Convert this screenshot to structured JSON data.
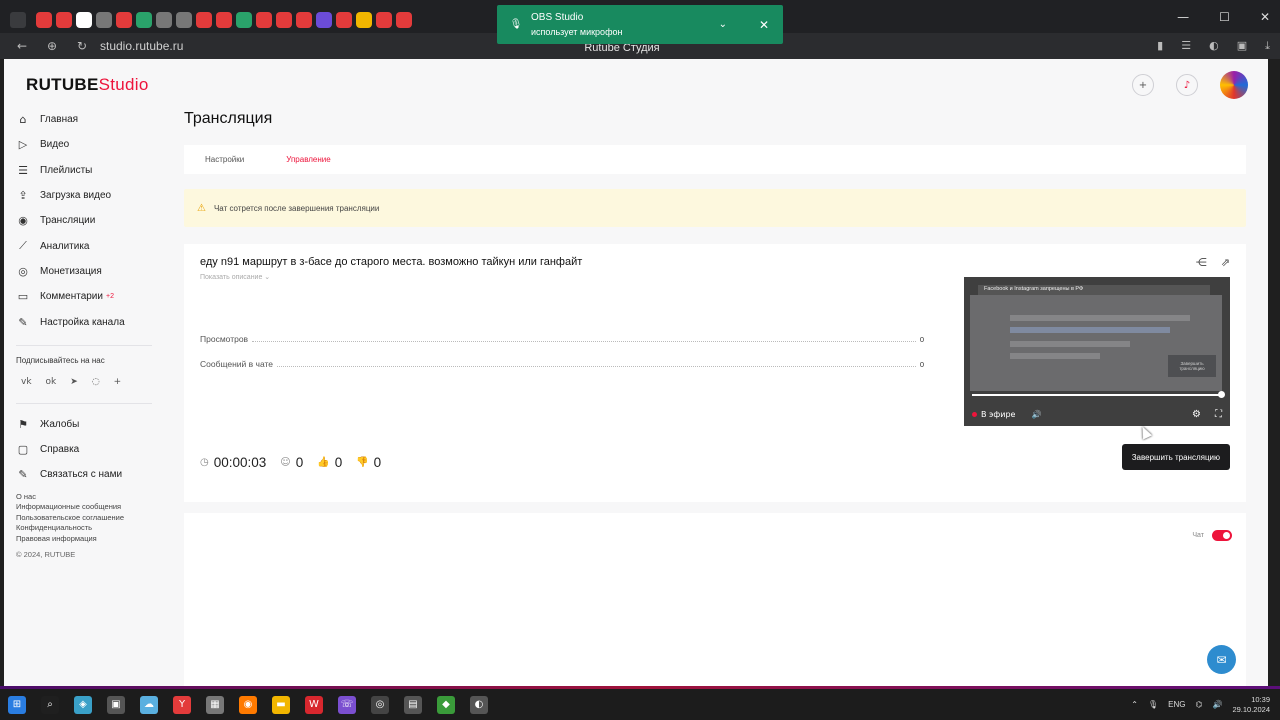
{
  "browser": {
    "url": "studio.rutube.ru",
    "page_title": "Rutube Студия",
    "tab_icon_colors": [
      "#e33b3b",
      "#e33b3b",
      "#ffffff",
      "#777777",
      "#e33b3b",
      "#2aa36b",
      "#777777",
      "#777777",
      "#e33b3b",
      "#e33b3b",
      "#2aa36b",
      "#e33b3b",
      "#e33b3b",
      "#e33b3b",
      "#6b4cd8",
      "#e33b3b",
      "#f2b600",
      "#e33b3b",
      "#e33b3b"
    ]
  },
  "obs_toast": {
    "title": "OBS Studio",
    "message": "использует микрофон"
  },
  "logo": {
    "part1": "RUTUBE",
    "part2": "Studio"
  },
  "sidebar": {
    "items": [
      {
        "label": "Главная",
        "icon": "home-icon",
        "glyph": "⌂"
      },
      {
        "label": "Видео",
        "icon": "video-icon",
        "glyph": "▷"
      },
      {
        "label": "Плейлисты",
        "icon": "playlist-icon",
        "glyph": "☰"
      },
      {
        "label": "Загрузка видео",
        "icon": "upload-icon",
        "glyph": "⇪"
      },
      {
        "label": "Трансляции",
        "icon": "broadcast-icon",
        "glyph": "◉"
      },
      {
        "label": "Аналитика",
        "icon": "analytics-icon",
        "glyph": "⟋"
      },
      {
        "label": "Монетизация",
        "icon": "monetization-icon",
        "glyph": "◎"
      },
      {
        "label": "Комментарии",
        "icon": "comments-icon",
        "glyph": "▭",
        "badge": "+2"
      },
      {
        "label": "Настройка канала",
        "icon": "channel-settings-icon",
        "glyph": "✎"
      }
    ],
    "subscribe_label": "Подписывайтесь на нас",
    "secondary_items": [
      {
        "label": "Жалобы",
        "icon": "flag-icon",
        "glyph": "⚑"
      },
      {
        "label": "Справка",
        "icon": "help-icon",
        "glyph": "▢"
      },
      {
        "label": "Связаться с нами",
        "icon": "contact-icon",
        "glyph": "✎"
      }
    ],
    "footer_links": [
      "О нас",
      "Информационные сообщения",
      "Пользовательское соглашение",
      "Конфиденциальность",
      "Правовая информация"
    ],
    "copyright": "© 2024, RUTUBE"
  },
  "main": {
    "page_title": "Трансляция",
    "tabs": [
      {
        "label": "Настройки",
        "active": false
      },
      {
        "label": "Управление",
        "active": true
      }
    ],
    "warning": "Чат сотрется после завершения трансляции",
    "stream": {
      "title": "еду n91 маршрут в з-басе до старого места. возможно тайкун или ганфайт",
      "show_description": "Показать описание",
      "stats": [
        {
          "label": "Просмотров",
          "value": "0"
        },
        {
          "label": "Сообщений в чате",
          "value": "0"
        }
      ],
      "timer": "00:00:03",
      "viewers": "0",
      "likes": "0",
      "dislikes": "0",
      "end_button": "Завершить трансляцию",
      "player": {
        "banner": "Facebook и Instagram запрещены в РФ",
        "live_label": "В эфире",
        "inner_button": "Завершить трансляцию",
        "progress_fraction": 1.0
      }
    },
    "chat": {
      "toggle_label": "Чат",
      "toggle_on": true
    }
  },
  "colors": {
    "accent": "#ed143b",
    "warning_bg": "#fdf8de",
    "support": "#2e8ccf"
  },
  "taskbar": {
    "lang": "ENG",
    "time": "10:39",
    "date": "29.10.2024",
    "icons": [
      "start-icon",
      "search-icon",
      "copilot-icon",
      "file-explorer-icon",
      "weather-icon",
      "yandex-browser-icon",
      "store-icon",
      "firefox-icon",
      "folder-icon",
      "wps-icon",
      "viber-icon",
      "obs-icon",
      "app-icon",
      "minecraft-icon",
      "app2-icon"
    ]
  }
}
